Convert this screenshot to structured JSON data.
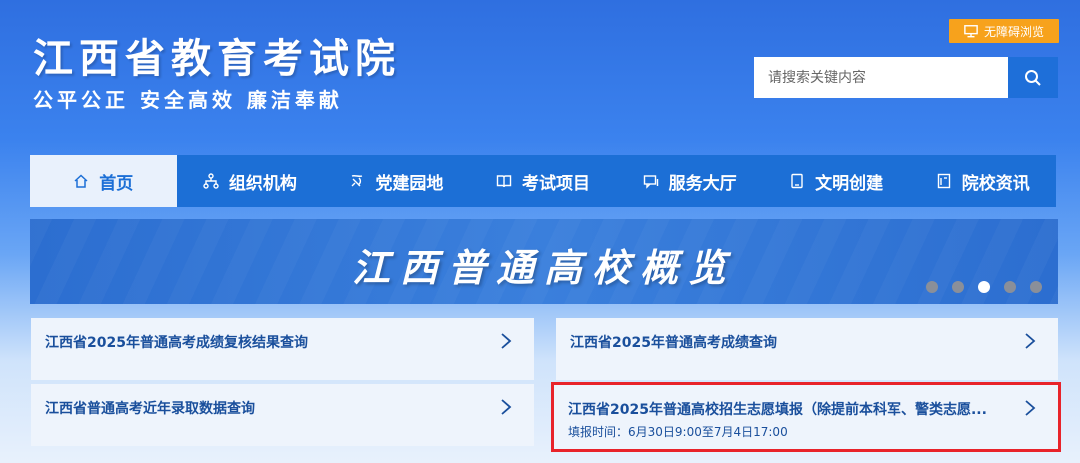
{
  "header": {
    "title": "江西省教育考试院",
    "slogan": "公平公正  安全高效  廉洁奉献",
    "a11y_label": "无障碍浏览",
    "search_placeholder": "请搜索关键内容"
  },
  "nav": {
    "items": [
      {
        "label": "首页",
        "icon": "home-icon"
      },
      {
        "label": "组织机构",
        "icon": "org-chart-icon"
      },
      {
        "label": "党建园地",
        "icon": "party-icon"
      },
      {
        "label": "考试项目",
        "icon": "book-icon"
      },
      {
        "label": "服务大厅",
        "icon": "service-icon"
      },
      {
        "label": "文明创建",
        "icon": "tablet-icon"
      },
      {
        "label": "院校资讯",
        "icon": "document-icon"
      }
    ],
    "active_index": 0
  },
  "banner": {
    "title": "江西普通高校概览",
    "dot_count": 5,
    "active_dot": 2
  },
  "cards": [
    {
      "title": "江西省2025年普通高考成绩复核结果查询",
      "subtitle": ""
    },
    {
      "title": "江西省2025年普通高考成绩查询",
      "subtitle": ""
    },
    {
      "title": "江西省普通高考近年录取数据查询",
      "subtitle": ""
    },
    {
      "title": "江西省2025年普通高校招生志愿填报（除提前本科军、警类志愿...",
      "subtitle": "填报时间：6月30日9:00至7月4日17:00"
    }
  ],
  "colors": {
    "nav_bg": "#1c6fd6",
    "accent_orange": "#f7a21c",
    "highlight_red": "#e8232a",
    "card_text": "#1a4f9c"
  }
}
